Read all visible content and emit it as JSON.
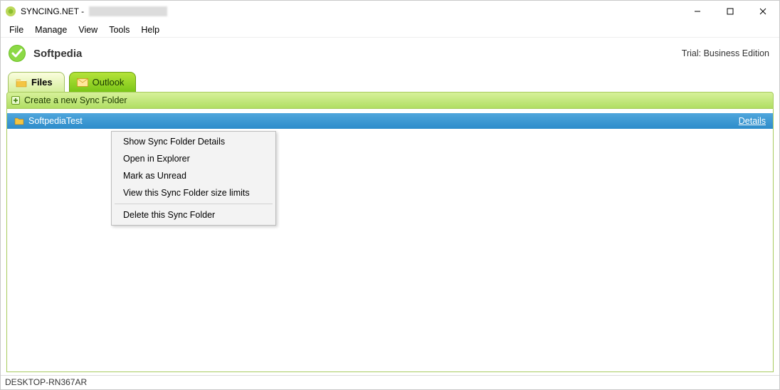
{
  "window": {
    "app_title_prefix": "SYNCING.NET -",
    "minimize": "—",
    "maximize": "☐",
    "close": "✕"
  },
  "menubar": [
    "File",
    "Manage",
    "View",
    "Tools",
    "Help"
  ],
  "header": {
    "account": "Softpedia",
    "trial_text": "Trial: Business Edition"
  },
  "tabs": {
    "files": "Files",
    "outlook": "Outlook"
  },
  "actionbar": {
    "create_label": "Create a new Sync Folder"
  },
  "list": {
    "items": [
      {
        "name": "SoftpediaTest",
        "details_label": "Details"
      }
    ]
  },
  "context_menu": {
    "items": [
      "Show Sync Folder Details",
      "Open in Explorer",
      "Mark as Unread",
      "View this Sync Folder size limits"
    ],
    "after_sep": [
      "Delete this Sync Folder"
    ]
  },
  "statusbar": {
    "host": "DESKTOP-RN367AR"
  }
}
